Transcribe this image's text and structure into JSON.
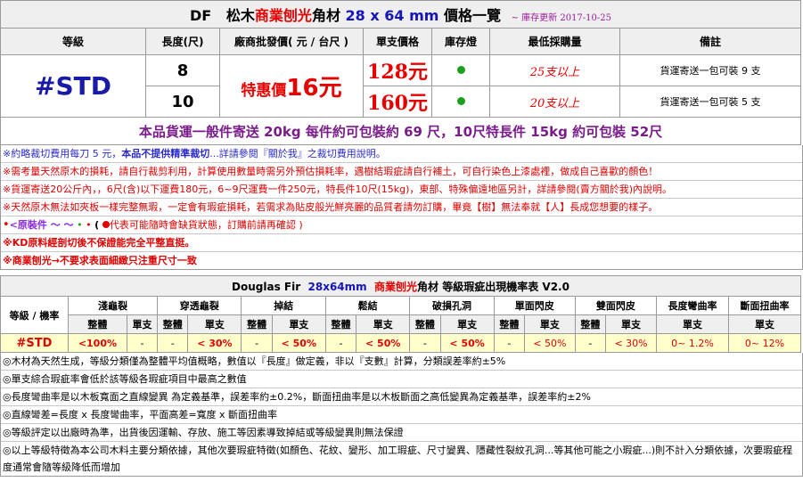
{
  "header": {
    "brand": "DF",
    "title_a": "松木",
    "title_b": "商業刨光",
    "title_c": "角材",
    "size": "28 x 64 mm",
    "title_d": "價格一覽",
    "update": "~ 庫存更新 2017-10-25"
  },
  "columns": [
    "等級",
    "長度(尺)",
    "廠商批發價( 元 / 台尺 )",
    "單支價格",
    "庫存燈",
    "最低採購量",
    "備註"
  ],
  "grade": "#STD",
  "special": {
    "prefix": "特惠價",
    "num": "16",
    "unit": "元"
  },
  "rows": [
    {
      "length": "8",
      "price": "128元",
      "min": "25支以上",
      "note": "貨運寄送一包可裝 9 支",
      "stock_color": "#1aa01a"
    },
    {
      "length": "10",
      "price": "160元",
      "min": "20支以上",
      "note": "貨運寄送一包可裝 5 支",
      "stock_color": "#1aa01a"
    }
  ],
  "shipping": "本品貨運一般件寄送 20kg 每件約可包裝約 69 尺，10尺特長件 15kg 約可包裝 52尺",
  "notes": {
    "n1a": "※約略裁切費用每刀 5 元，",
    "n1b": "本品不提供精準裁切",
    "n1c": "...詳請參閱『關於我』之裁切費用說明。",
    "n2": "※需考量天然原木的損耗，請自行裁剪利用，計算使用數量時需另外預估損耗率，遇樹結瑕疵請自行補土，可自行染色上漆處裡，做成自己喜歡的顏色！",
    "n3": "※貨運寄送20公斤內，，6尺(含)以下運費180元，6~9尺運費一件250元，特長件10尺(15kg)，東部、特殊偏遠地區另計，詳請參閱(賣方關於我)內說明。",
    "n4": "※天然原木無法如夾板一樣完整無瑕，一定會有瑕疵損耗，若需求為貼皮般光鮮亮麗的品質者請勿訂購，畢竟【樹】無法奉就【人】長成您想要的樣子。",
    "n5a": "<原裝件 ～ ～",
    "n5b": "( ",
    "n5c": "代表可能隨時會缺貨狀態，訂購前請再確認 )",
    "n6": "※KD原料經剖切後不保證能完全平整直挺。",
    "n7": "※商業刨光→不要求表面細緻只注重尺寸一致"
  },
  "defect_table": {
    "caption_a": "Douglas Fir",
    "caption_b": "28x64mm",
    "caption_c": "商業刨光",
    "caption_d": "角材 等級瑕疵出現機率表 V2.0",
    "rowhead": "等級 / 機率",
    "groups": [
      "淺龜裂",
      "穿透龜裂",
      "掉結",
      "鬆結",
      "破損孔洞",
      "單面閃皮",
      "雙面閃皮",
      "長度彎曲率",
      "斷面扭曲率"
    ],
    "sub_whole": "整體",
    "sub_single": "單支",
    "grade": "#STD",
    "values": [
      "<100%",
      "-",
      "-",
      "< 30%",
      "-",
      "< 50%",
      "-",
      "< 50%",
      "-",
      "< 50%",
      "-",
      "< 50%",
      "-",
      "< 30%",
      "0~ 1.2%",
      "0~ 12%"
    ]
  },
  "spec_notes": [
    "◎木材為天然生成，等級分類僅為整體平均值概略，數值以『長度』做定義，非以『支數』計算，分類誤差率約±5%",
    "◎單支綜合瑕疵率會低於該等級各瑕疵項目中最高之數值",
    "◎長度彎曲率是以木板寬面之直線變異 為定義基準，誤差率約±0.2%，斷面扭曲率是以木板斷面之高低變異為定義基準，誤差率約±2%",
    "◎直線彎差=長度 x 長度彎曲率，平面高差=寬度 x 斷面扭曲率",
    "◎等級評定以出廠時為準，出貨後因運輸、存放、施工等因素導致掉結或等級變異則無法保證",
    "◎以上等級特徵為本公司木料主要分類依據，其他次要瑕疵特徵(如顏色、花紋、變形、加工瑕疵、尺寸變異、隱藏性裂紋孔洞...等其他可能之小瑕疵...)則不計入分類依據，次要瑕疵程度通常會隨等級降低而增加"
  ]
}
